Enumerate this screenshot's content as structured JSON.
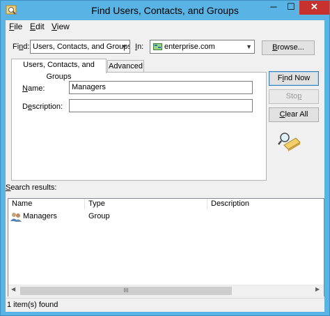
{
  "window": {
    "title": "Find Users, Contacts, and Groups",
    "minimize_glyph": "─",
    "maximize_glyph": "☐",
    "close_glyph": "✕"
  },
  "menu": [
    {
      "mnemonic": "F",
      "rest": "ile"
    },
    {
      "mnemonic": "E",
      "rest": "dit"
    },
    {
      "mnemonic": "V",
      "rest": "iew"
    }
  ],
  "find": {
    "label_mnemonic": "n",
    "label_prefix": "Fi",
    "label_suffix": "d:",
    "value": "Users, Contacts, and Groups"
  },
  "in": {
    "label_mnemonic": "I",
    "label_suffix": "n:",
    "value": "enterprise.com"
  },
  "browse_button": {
    "mnemonic": "B",
    "rest": "rowse..."
  },
  "tabs": [
    {
      "label": "Users, Contacts, and Groups",
      "active": true
    },
    {
      "label": "Advanced",
      "active": false
    }
  ],
  "form": {
    "name_label_mnemonic": "N",
    "name_label_rest": "ame:",
    "name_value": "Managers",
    "description_label_mnemonic": "e",
    "description_label_prefix": "D",
    "description_label_rest": "scription:",
    "description_value": ""
  },
  "buttons": {
    "find_now": {
      "mnemonic": "i",
      "prefix": "F",
      "rest": "nd Now"
    },
    "stop": {
      "mnemonic": "p",
      "prefix": "Sto",
      "rest": ""
    },
    "clear_all": {
      "mnemonic": "C",
      "prefix": "",
      "rest": "lear All"
    }
  },
  "results": {
    "label_mnemonic": "S",
    "label_rest": "earch results:",
    "columns": [
      "Name",
      "Type",
      "Description"
    ],
    "rows": [
      {
        "name": "Managers",
        "type": "Group",
        "description": "",
        "icon": "group-icon"
      }
    ],
    "scroll_grip": "III"
  },
  "status": "1 item(s) found",
  "colors": {
    "titlebar": "#59b4e5",
    "close_button": "#c7312e",
    "client_bg": "#f0f0f0"
  }
}
